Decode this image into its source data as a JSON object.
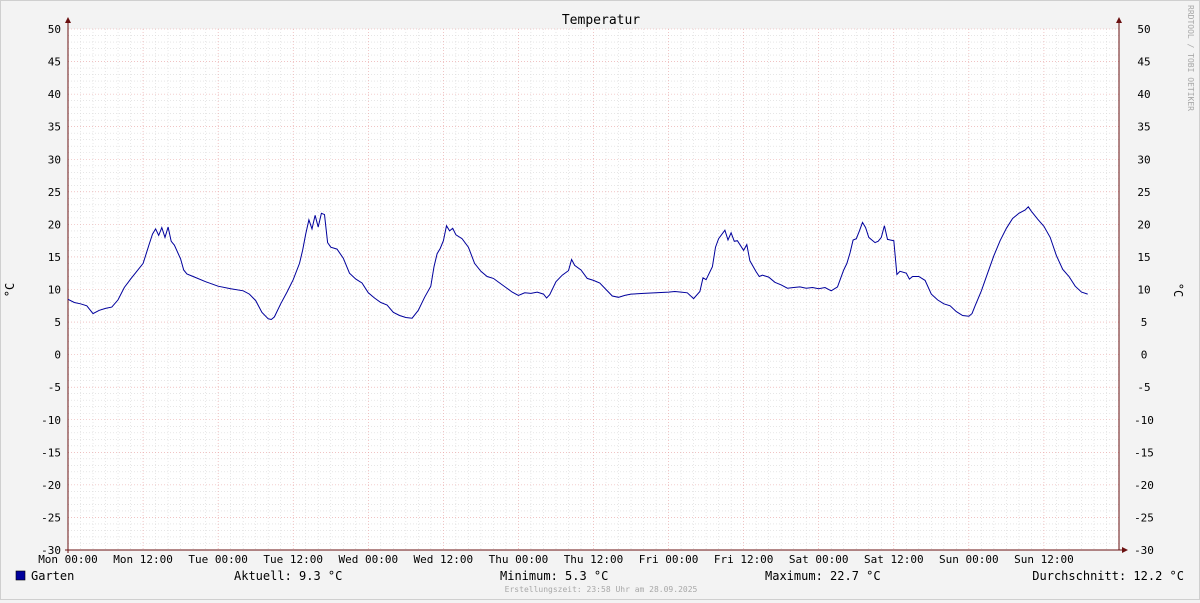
{
  "chart_data": {
    "type": "line",
    "title": "Temperatur",
    "ylabel": "°C",
    "ylim": [
      -30,
      50
    ],
    "y_ticks": [
      50,
      45,
      40,
      35,
      30,
      25,
      20,
      15,
      10,
      5,
      0,
      -5,
      -10,
      -15,
      -20,
      -25,
      -30
    ],
    "x_range_hours": [
      0,
      168
    ],
    "x_tick_labels": [
      "Mon 00:00",
      "Mon 12:00",
      "Tue 00:00",
      "Tue 12:00",
      "Wed 00:00",
      "Wed 12:00",
      "Thu 00:00",
      "Thu 12:00",
      "Fri 00:00",
      "Fri 12:00",
      "Sat 00:00",
      "Sat 12:00",
      "Sun 00:00",
      "Sun 12:00"
    ],
    "grid": true,
    "series": [
      {
        "name": "Garten",
        "color": "#00009c",
        "x_unit": "hours since Mon 00:00",
        "points": [
          [
            0,
            8.5
          ],
          [
            1,
            8.0
          ],
          [
            2,
            7.8
          ],
          [
            3,
            7.5
          ],
          [
            4,
            6.3
          ],
          [
            5,
            6.8
          ],
          [
            6,
            7.1
          ],
          [
            7,
            7.3
          ],
          [
            8,
            8.4
          ],
          [
            9,
            10.3
          ],
          [
            10,
            11.6
          ],
          [
            11,
            12.8
          ],
          [
            12,
            14.0
          ],
          [
            12.5,
            15.5
          ],
          [
            13,
            17.0
          ],
          [
            13.5,
            18.5
          ],
          [
            14,
            19.3
          ],
          [
            14.5,
            18.3
          ],
          [
            15,
            19.5
          ],
          [
            15.5,
            18.0
          ],
          [
            16,
            19.6
          ],
          [
            16.5,
            17.4
          ],
          [
            17,
            16.8
          ],
          [
            18,
            14.7
          ],
          [
            18.5,
            13.0
          ],
          [
            19,
            12.4
          ],
          [
            20,
            12.0
          ],
          [
            22,
            11.2
          ],
          [
            24,
            10.5
          ],
          [
            26,
            10.1
          ],
          [
            28,
            9.8
          ],
          [
            29,
            9.3
          ],
          [
            30,
            8.3
          ],
          [
            31,
            6.5
          ],
          [
            32,
            5.5
          ],
          [
            32.5,
            5.4
          ],
          [
            33,
            5.8
          ],
          [
            34,
            7.8
          ],
          [
            35,
            9.6
          ],
          [
            36,
            11.5
          ],
          [
            37,
            14.0
          ],
          [
            37.5,
            16.0
          ],
          [
            38,
            18.5
          ],
          [
            38.5,
            20.7
          ],
          [
            39,
            19.3
          ],
          [
            39.5,
            21.4
          ],
          [
            40,
            19.6
          ],
          [
            40.5,
            21.7
          ],
          [
            41,
            21.5
          ],
          [
            41.5,
            17.2
          ],
          [
            42,
            16.5
          ],
          [
            43,
            16.2
          ],
          [
            44,
            14.8
          ],
          [
            45,
            12.5
          ],
          [
            46,
            11.6
          ],
          [
            47,
            11.0
          ],
          [
            48,
            9.5
          ],
          [
            49,
            8.7
          ],
          [
            50,
            8.0
          ],
          [
            51,
            7.6
          ],
          [
            52,
            6.5
          ],
          [
            53,
            6.0
          ],
          [
            54,
            5.7
          ],
          [
            55,
            5.6
          ],
          [
            56,
            6.8
          ],
          [
            57,
            8.8
          ],
          [
            58,
            10.5
          ],
          [
            58.5,
            13.5
          ],
          [
            59,
            15.5
          ],
          [
            59.5,
            16.3
          ],
          [
            60,
            17.5
          ],
          [
            60.5,
            19.8
          ],
          [
            61,
            19.0
          ],
          [
            61.5,
            19.4
          ],
          [
            62,
            18.4
          ],
          [
            63,
            17.8
          ],
          [
            64,
            16.5
          ],
          [
            65,
            14.0
          ],
          [
            66,
            12.8
          ],
          [
            67,
            12.0
          ],
          [
            68,
            11.7
          ],
          [
            69,
            11.0
          ],
          [
            70,
            10.3
          ],
          [
            71,
            9.6
          ],
          [
            72,
            9.1
          ],
          [
            73,
            9.5
          ],
          [
            74,
            9.4
          ],
          [
            75,
            9.6
          ],
          [
            76,
            9.3
          ],
          [
            76.5,
            8.7
          ],
          [
            77,
            9.2
          ],
          [
            78,
            11.2
          ],
          [
            79,
            12.2
          ],
          [
            80,
            12.9
          ],
          [
            80.5,
            14.6
          ],
          [
            81,
            13.7
          ],
          [
            82,
            13.0
          ],
          [
            83,
            11.7
          ],
          [
            84,
            11.4
          ],
          [
            85,
            11.0
          ],
          [
            86,
            10.0
          ],
          [
            87,
            9.0
          ],
          [
            88,
            8.8
          ],
          [
            89,
            9.1
          ],
          [
            90,
            9.3
          ],
          [
            92,
            9.4
          ],
          [
            94,
            9.5
          ],
          [
            96,
            9.6
          ],
          [
            97,
            9.7
          ],
          [
            98,
            9.6
          ],
          [
            99,
            9.5
          ],
          [
            100,
            8.6
          ],
          [
            101,
            9.7
          ],
          [
            101.5,
            11.8
          ],
          [
            102,
            11.5
          ],
          [
            103,
            13.5
          ],
          [
            103.5,
            16.5
          ],
          [
            104,
            17.8
          ],
          [
            105,
            19.1
          ],
          [
            105.5,
            17.6
          ],
          [
            106,
            18.7
          ],
          [
            106.5,
            17.4
          ],
          [
            107,
            17.5
          ],
          [
            108,
            16.0
          ],
          [
            108.5,
            16.9
          ],
          [
            109,
            14.4
          ],
          [
            110,
            12.7
          ],
          [
            110.5,
            12.0
          ],
          [
            111,
            12.2
          ],
          [
            112,
            11.9
          ],
          [
            113,
            11.1
          ],
          [
            114,
            10.7
          ],
          [
            115,
            10.2
          ],
          [
            116,
            10.3
          ],
          [
            117,
            10.4
          ],
          [
            118,
            10.2
          ],
          [
            119,
            10.3
          ],
          [
            120,
            10.1
          ],
          [
            121,
            10.3
          ],
          [
            122,
            9.8
          ],
          [
            123,
            10.4
          ],
          [
            124,
            13.0
          ],
          [
            124.5,
            14.0
          ],
          [
            125,
            15.6
          ],
          [
            125.5,
            17.6
          ],
          [
            126,
            17.8
          ],
          [
            126.5,
            19.0
          ],
          [
            127,
            20.3
          ],
          [
            127.5,
            19.5
          ],
          [
            128,
            18.0
          ],
          [
            129,
            17.2
          ],
          [
            129.5,
            17.4
          ],
          [
            130,
            18.0
          ],
          [
            130.5,
            19.8
          ],
          [
            131,
            17.7
          ],
          [
            132,
            17.5
          ],
          [
            132.5,
            12.3
          ],
          [
            133,
            12.8
          ],
          [
            134,
            12.5
          ],
          [
            134.5,
            11.6
          ],
          [
            135,
            12.0
          ],
          [
            136,
            12.0
          ],
          [
            137,
            11.4
          ],
          [
            138,
            9.3
          ],
          [
            139,
            8.4
          ],
          [
            140,
            7.8
          ],
          [
            141,
            7.5
          ],
          [
            142,
            6.6
          ],
          [
            143,
            6.0
          ],
          [
            144,
            5.9
          ],
          [
            144.5,
            6.3
          ],
          [
            145,
            7.5
          ],
          [
            146,
            9.8
          ],
          [
            147,
            12.5
          ],
          [
            148,
            15.2
          ],
          [
            149,
            17.5
          ],
          [
            150,
            19.4
          ],
          [
            151,
            20.9
          ],
          [
            152,
            21.7
          ],
          [
            153,
            22.2
          ],
          [
            153.5,
            22.7
          ],
          [
            154,
            22.0
          ],
          [
            155,
            20.8
          ],
          [
            156,
            19.7
          ],
          [
            157,
            18.0
          ],
          [
            158,
            15.2
          ],
          [
            159,
            13.1
          ],
          [
            160,
            12.0
          ],
          [
            161,
            10.5
          ],
          [
            162,
            9.6
          ],
          [
            163,
            9.3
          ]
        ]
      }
    ],
    "legend": "bottom-left"
  },
  "legend": {
    "series_name": "Garten",
    "series_color": "#00009c",
    "current": "Aktuell: 9.3 °C",
    "minimum": "Minimum: 5.3 °C",
    "maximum": "Maximum: 22.7 °C",
    "average": "Durchschnitt: 12.2 °C"
  },
  "footer": "Erstellungszeit: 23:58 Uhr am 28.09.2025",
  "watermark": "RRDTOOL / TOBI OETIKER",
  "colors": {
    "background": "#f3f3f3",
    "plot_background": "#ffffff",
    "major_grid": "#e8a0a0",
    "minor_grid": "#d8d8d8",
    "axis": "#6a1010",
    "line": "#00009c"
  }
}
